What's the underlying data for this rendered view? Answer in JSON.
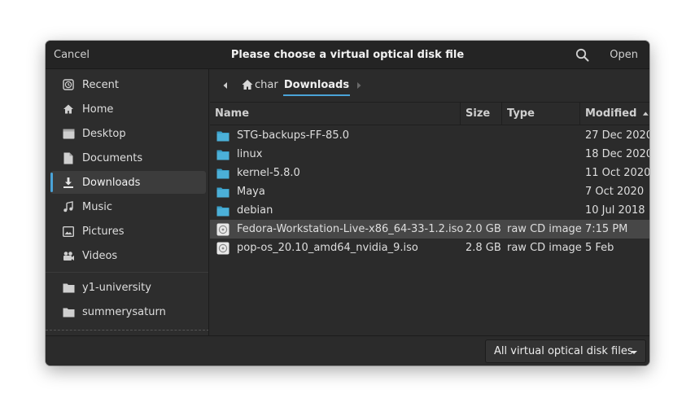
{
  "headerbar": {
    "cancel_label": "Cancel",
    "title": "Please choose a virtual optical disk file",
    "search_icon": "search-icon",
    "open_label": "Open"
  },
  "sidebar": {
    "items": [
      {
        "label": "Recent",
        "icon": "clock-icon"
      },
      {
        "label": "Home",
        "icon": "home-icon"
      },
      {
        "label": "Desktop",
        "icon": "desktop-folder-icon"
      },
      {
        "label": "Documents",
        "icon": "document-icon"
      },
      {
        "label": "Downloads",
        "icon": "download-icon",
        "selected": true
      },
      {
        "label": "Music",
        "icon": "music-note-icon"
      },
      {
        "label": "Pictures",
        "icon": "picture-icon"
      },
      {
        "label": "Videos",
        "icon": "video-icon"
      }
    ],
    "bookmarks": [
      {
        "label": "y1-university",
        "icon": "folder-icon"
      },
      {
        "label": "summerysaturn",
        "icon": "folder-icon"
      }
    ]
  },
  "pathbar": {
    "home_label": "char",
    "current_label": "Downloads"
  },
  "columns": {
    "name": "Name",
    "size": "Size",
    "type": "Type",
    "modified": "Modified",
    "sort": "modified-descending"
  },
  "files": [
    {
      "name": "STG-backups-FF-85.0",
      "size": "",
      "type": "",
      "modified": "27 Dec 2020",
      "kind": "folder"
    },
    {
      "name": "linux",
      "size": "",
      "type": "",
      "modified": "18 Dec 2020",
      "kind": "folder"
    },
    {
      "name": "kernel-5.8.0",
      "size": "",
      "type": "",
      "modified": "11 Oct 2020",
      "kind": "folder"
    },
    {
      "name": "Maya",
      "size": "",
      "type": "",
      "modified": "7 Oct 2020",
      "kind": "folder"
    },
    {
      "name": "debian",
      "size": "",
      "type": "",
      "modified": "10 Jul 2018",
      "kind": "folder"
    },
    {
      "name": "Fedora-Workstation-Live-x86_64-33-1.2.iso",
      "size": "2.0 GB",
      "type": "raw CD image",
      "modified": "7:15 PM",
      "kind": "disc",
      "selected": true
    },
    {
      "name": "pop-os_20.10_amd64_nvidia_9.iso",
      "size": "2.8 GB",
      "type": "raw CD image",
      "modified": "5 Feb",
      "kind": "disc"
    }
  ],
  "footer": {
    "filter_label": "All virtual optical disk files"
  },
  "colors": {
    "accent": "#4aa3d8",
    "folder": "#3a9fc8",
    "background": "#2b2b2b",
    "selected_row": "#474747"
  }
}
